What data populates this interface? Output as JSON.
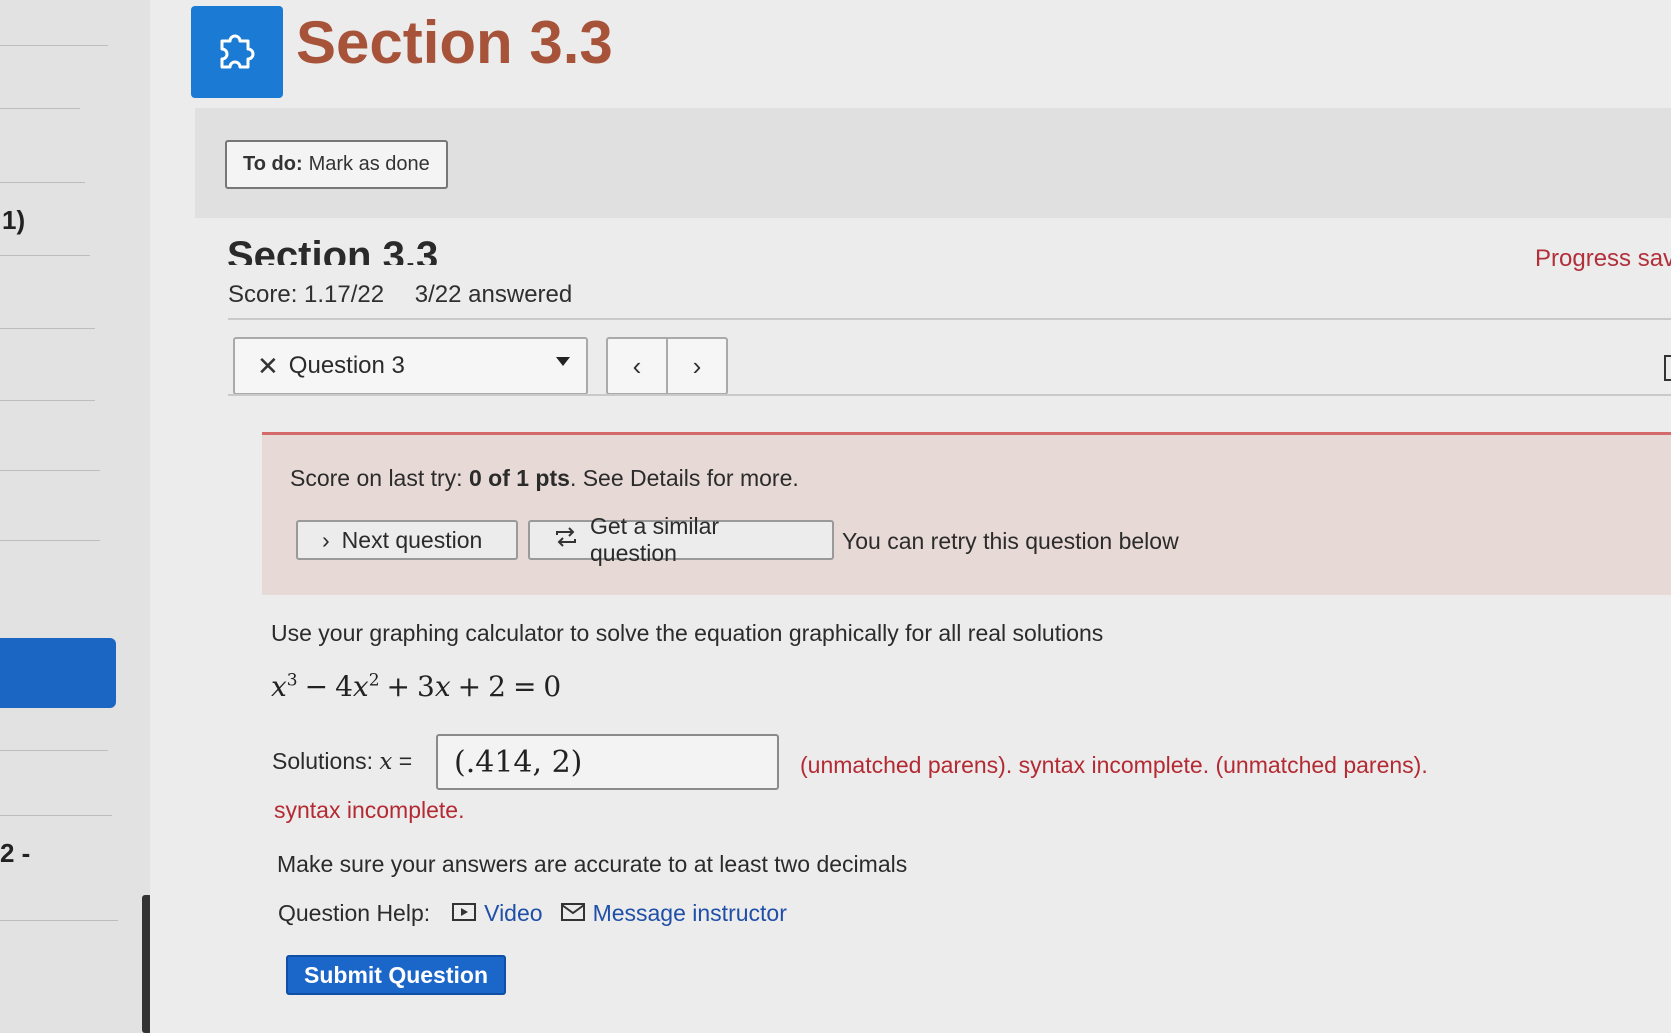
{
  "sidebar": {
    "item_number_top": "1)",
    "item_number_bottom": "2 -"
  },
  "header": {
    "title": "Section 3.3",
    "icon": "puzzle-icon"
  },
  "todo": {
    "label": "To do:",
    "action": "Mark as done"
  },
  "assignment": {
    "heading": "Section 3.3",
    "score": "Score: 1.17/22",
    "answered": "3/22 answered",
    "progress_status": "Progress sav"
  },
  "question_nav": {
    "selected": "Question 3",
    "status_icon": "x-icon",
    "prev_icon": "chevron-left-icon",
    "next_icon": "chevron-right-icon"
  },
  "alert": {
    "prefix": "Score on last try: ",
    "score_bold": "0 of 1 pts",
    "suffix": ". See Details for more.",
    "next_button": "Next question",
    "similar_button": "Get a similar question",
    "retry_text": "You can retry this question below",
    "color_border": "#d46a6a",
    "color_background": "#e6d9d6"
  },
  "question": {
    "instruction": "Use your graphing calculator to solve the equation graphically for all real solutions",
    "solutions_label": "Solutions:",
    "answer_value": "(.414, 2)",
    "error_line1": "(unmatched parens). syntax incomplete. (unmatched parens).",
    "error_line2": "syntax incomplete.",
    "accuracy_note": "Make sure your answers are accurate to at least two decimals",
    "help_label": "Question Help:",
    "video_link": "Video",
    "message_link": "Message instructor",
    "submit_label": "Submit Question"
  },
  "colors": {
    "accent": "#1b66c9",
    "title": "#a7533a",
    "error": "#b42a33"
  }
}
